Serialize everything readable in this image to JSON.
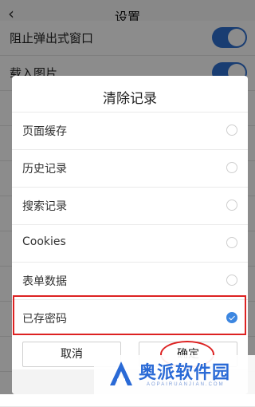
{
  "header": {
    "title": "设置"
  },
  "background_rows": [
    {
      "label": "阻止弹出式窗口"
    },
    {
      "label": "载入图片"
    }
  ],
  "dialog": {
    "title": "清除记录",
    "options": [
      {
        "label": "页面缓存",
        "checked": false
      },
      {
        "label": "历史记录",
        "checked": false
      },
      {
        "label": "搜索记录",
        "checked": false
      },
      {
        "label": "Cookies",
        "checked": false
      },
      {
        "label": "表单数据",
        "checked": false
      },
      {
        "label": "已存密码",
        "checked": true
      }
    ],
    "cancel_label": "取消",
    "ok_label": "确定"
  },
  "watermark": {
    "brand": "奥派软件园",
    "url": "AOPAIRUANJIAN.COM"
  },
  "colors": {
    "accent": "#3c86e0",
    "annotation": "#dd2222",
    "toggle": "#2f6fcf"
  }
}
